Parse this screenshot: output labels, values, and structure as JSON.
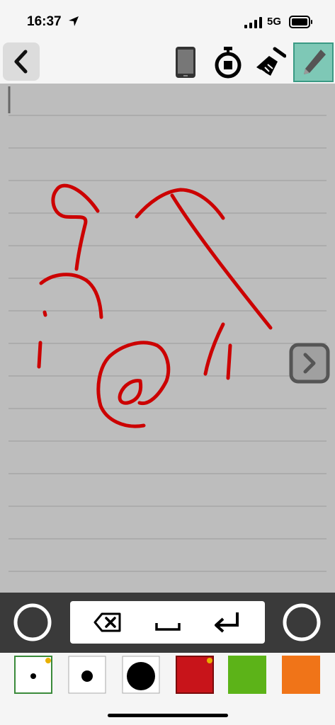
{
  "status": {
    "time": "16:37",
    "network": "5G",
    "icons": [
      "location-arrow-icon",
      "signal-bars-icon",
      "battery-icon"
    ]
  },
  "toolbar": {
    "icons": [
      "back-chevron-icon",
      "phone-icon",
      "stopwatch-icon",
      "broom-icon",
      "pencil-icon"
    ],
    "active_tool": "pencil"
  },
  "canvas": {
    "background": "#bdbdbd",
    "ink_color": "#cc0000",
    "next_icon": "chevron-right-icon"
  },
  "keys": [
    "backspace-icon",
    "space-icon",
    "return-icon"
  ],
  "palette": {
    "swatches": [
      {
        "name": "small-dot",
        "color": "#ffffff",
        "selected": true
      },
      {
        "name": "medium-dot",
        "color": "#ffffff"
      },
      {
        "name": "large-dot",
        "color": "#ffffff"
      },
      {
        "name": "red",
        "color": "#c8141a",
        "selected": true
      },
      {
        "name": "green",
        "color": "#5cb318"
      },
      {
        "name": "orange",
        "color": "#f07418"
      }
    ]
  }
}
